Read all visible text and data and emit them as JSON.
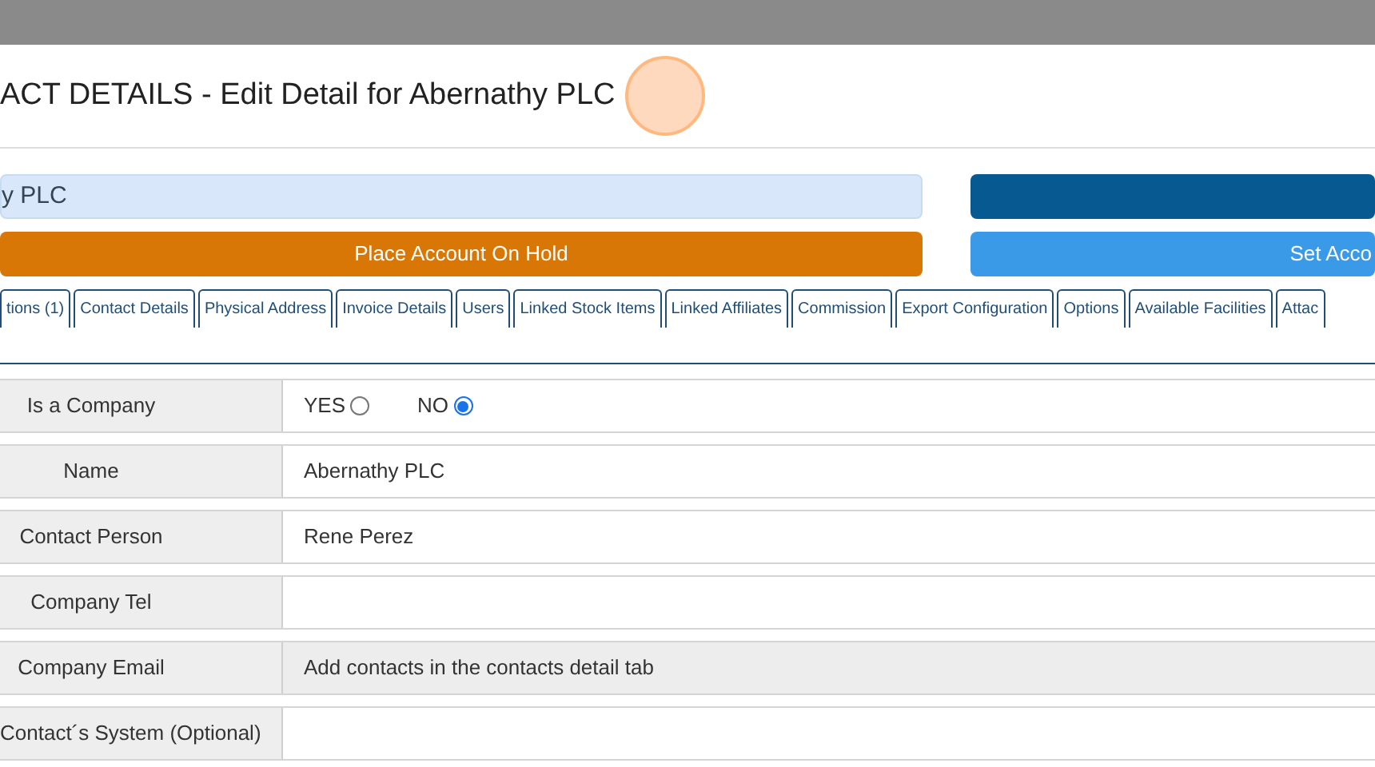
{
  "window": {
    "title": "ACT DETAILS - Edit Detail for Abernathy PLC"
  },
  "account_name": {
    "value": "y PLC"
  },
  "buttons": [
    {
      "kind": "primary"
    },
    {
      "kind": "hold",
      "label": "Place Account On Hold"
    },
    {
      "kind": "set",
      "label": "Set Acco"
    }
  ],
  "tabs": [
    {
      "label": "tions (1)",
      "selected": false
    },
    {
      "label": "Contact Details",
      "selected": false
    },
    {
      "label": "Physical Address",
      "selected": false
    },
    {
      "label": "Invoice Details",
      "selected": false
    },
    {
      "label": "Users",
      "selected": false
    },
    {
      "label": "Linked Stock Items",
      "selected": false
    },
    {
      "label": "Linked Affiliates",
      "selected": false
    },
    {
      "label": "Commission",
      "selected": false
    },
    {
      "label": "Export Configuration",
      "selected": false
    },
    {
      "label": "Options",
      "selected": false
    },
    {
      "label": "Available Facilities",
      "selected": false
    },
    {
      "label": "Attac",
      "selected": false
    }
  ],
  "form": [
    {
      "kind": "radio",
      "label": "Is a Company",
      "options": [
        {
          "label": "YES",
          "selected": false
        },
        {
          "label": "NO",
          "selected": true
        }
      ]
    },
    {
      "kind": "text",
      "label": "Name",
      "value": "Abernathy PLC",
      "disabled": false
    },
    {
      "kind": "text",
      "label": "Contact Person",
      "value": "Rene Perez",
      "disabled": false
    },
    {
      "kind": "text",
      "label": "Company Tel",
      "disabled": false
    },
    {
      "kind": "text",
      "label": "Company Email",
      "value": "Add contacts in the contacts detail tab",
      "disabled": true
    },
    {
      "kind": "text",
      "label": "Contact´s System (Optional)",
      "disabled": false
    }
  ]
}
